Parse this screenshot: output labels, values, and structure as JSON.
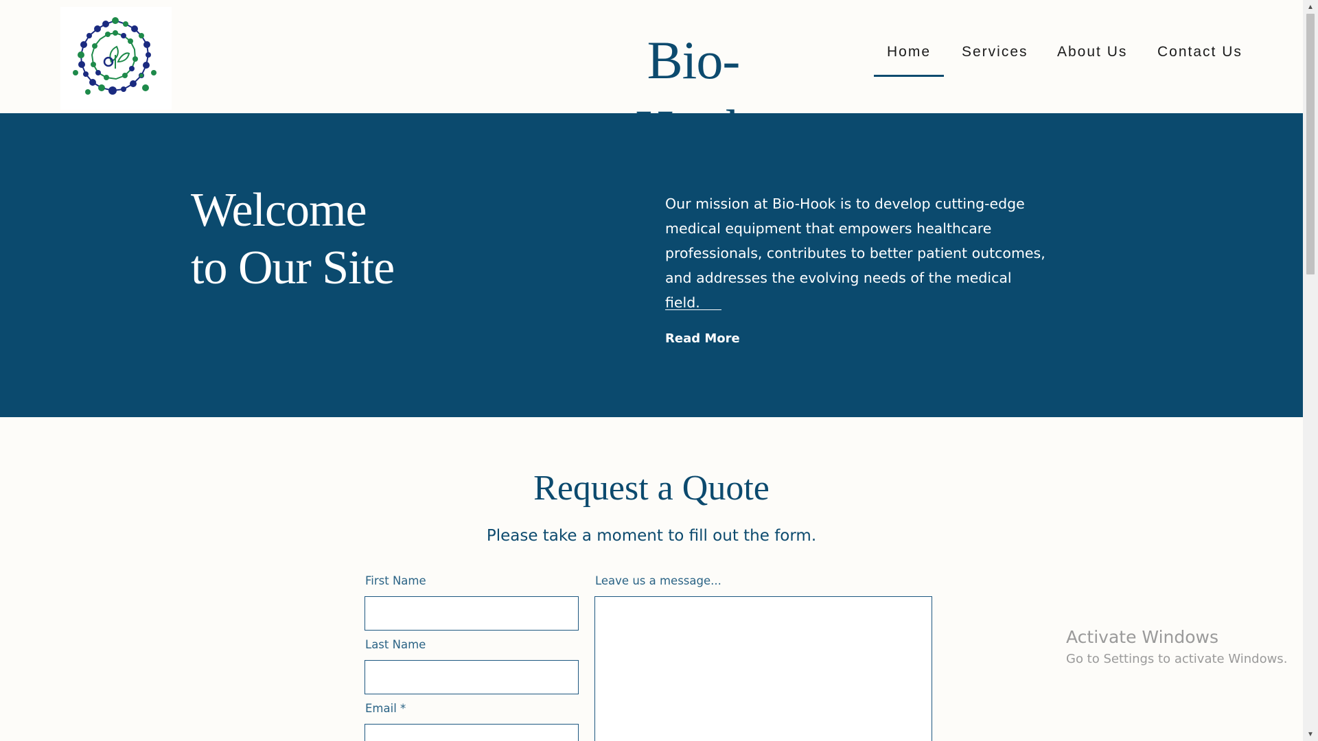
{
  "header": {
    "brand": "Bio-Hook",
    "nav": [
      {
        "label": "Home",
        "active": true
      },
      {
        "label": "Services",
        "active": false
      },
      {
        "label": "About Us",
        "active": false
      },
      {
        "label": "Contact Us",
        "active": false
      }
    ]
  },
  "hero": {
    "title_line1": "Welcome",
    "title_line2": "to Our Site",
    "text": "Our mission at Bio-Hook is to develop cutting-edge medical equipment that empowers healthcare professionals, contributes to better patient outcomes, and addresses the evolving needs of the medical field.",
    "link": "Read More"
  },
  "quote": {
    "title": "Request a Quote",
    "subtitle": "Please take a moment to fill out the form.",
    "fields": {
      "first_name": {
        "label": "First Name",
        "value": ""
      },
      "last_name": {
        "label": "Last Name",
        "value": ""
      },
      "email": {
        "label": "Email *",
        "value": ""
      },
      "message": {
        "label": "Leave us a message...",
        "value": ""
      }
    }
  },
  "watermark": {
    "title": "Activate Windows",
    "subtitle": "Go to Settings to activate Windows."
  },
  "colors": {
    "brand_blue": "#0c4a6e",
    "hero_bg": "#0b4a6e",
    "logo_blue": "#1a2a80",
    "logo_green": "#1e8a4a",
    "page_bg": "#fdfcf9"
  },
  "icons": {
    "logo": "molecule-spiral-logo",
    "scroll_up": "chevron-up-icon",
    "scroll_down": "chevron-down-icon"
  }
}
